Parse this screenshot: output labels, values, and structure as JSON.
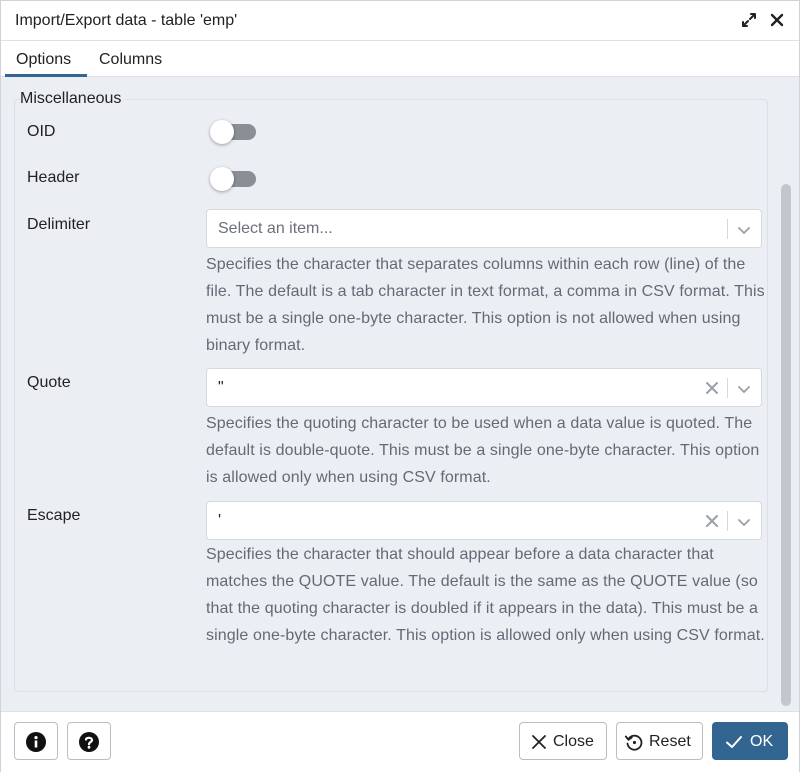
{
  "dialog": {
    "title": "Import/Export data - table 'emp'"
  },
  "tabs": [
    {
      "label": "Options"
    },
    {
      "label": "Columns"
    }
  ],
  "section": {
    "legend": "Miscellaneous"
  },
  "fields": {
    "oid": {
      "label": "OID",
      "enabled": false
    },
    "header": {
      "label": "Header",
      "enabled": false
    },
    "delimiter": {
      "label": "Delimiter",
      "placeholder": "Select an item...",
      "help": "Specifies the character that separates columns within each row (line) of the file. The default is a tab character in text format, a comma in CSV format. This must be a single one-byte character. This option is not allowed when using binary format."
    },
    "quote": {
      "label": "Quote",
      "value": "\"",
      "help": "Specifies the quoting character to be used when a data value is quoted. The default is double-quote. This must be a single one-byte character. This option is allowed only when using CSV format."
    },
    "escape": {
      "label": "Escape",
      "value": "'",
      "help": "Specifies the character that should appear before a data character that matches the QUOTE value. The default is the same as the QUOTE value (so that the quoting character is doubled if it appears in the data). This must be a single one-byte character. This option is allowed only when using CSV format."
    }
  },
  "footer": {
    "close_label": "Close",
    "reset_label": "Reset",
    "ok_label": "OK"
  },
  "colors": {
    "primary": "#326690",
    "toggle_off": "#8a8f96",
    "help_text": "#646a75"
  },
  "icons": [
    "expand-icon",
    "close-icon",
    "chevron-down-icon",
    "clear-icon",
    "info-icon",
    "help-icon",
    "reset-icon",
    "check-icon"
  ]
}
